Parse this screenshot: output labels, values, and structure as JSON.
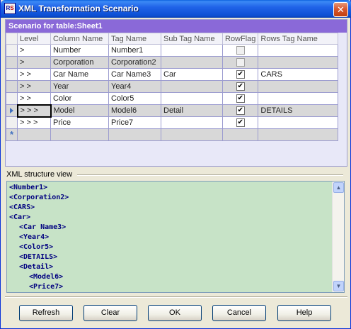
{
  "window": {
    "title": "XML Transformation Scenario",
    "icon_text_left": "R",
    "icon_text_right": "S",
    "close_glyph": "✕"
  },
  "scenario": {
    "header": "Scenario for table:Sheet1",
    "columns": [
      "Level",
      "Column Name",
      "Tag Name",
      "Sub Tag Name",
      "RowFlag",
      "Rows Tag Name"
    ],
    "rows": [
      {
        "level": ">",
        "column_name": "Number",
        "tag_name": "Number1",
        "sub_tag": "",
        "row_flag": false,
        "rows_tag": "",
        "shaded": false,
        "selected": false
      },
      {
        "level": ">",
        "column_name": "Corporation",
        "tag_name": "Corporation2",
        "sub_tag": "",
        "row_flag": false,
        "rows_tag": "",
        "shaded": true,
        "selected": false
      },
      {
        "level": "> >",
        "column_name": "Car Name",
        "tag_name": "Car Name3",
        "sub_tag": "Car",
        "row_flag": true,
        "rows_tag": "CARS",
        "shaded": false,
        "selected": false
      },
      {
        "level": "> >",
        "column_name": "Year",
        "tag_name": "Year4",
        "sub_tag": "",
        "row_flag": true,
        "rows_tag": "",
        "shaded": true,
        "selected": false
      },
      {
        "level": "> >",
        "column_name": "Color",
        "tag_name": "Color5",
        "sub_tag": "",
        "row_flag": true,
        "rows_tag": "",
        "shaded": false,
        "selected": false
      },
      {
        "level": "> > >",
        "column_name": "Model",
        "tag_name": "Model6",
        "sub_tag": "Detail",
        "row_flag": true,
        "rows_tag": "DETAILS",
        "shaded": true,
        "selected": true
      },
      {
        "level": "> > >",
        "column_name": "Price",
        "tag_name": "Price7",
        "sub_tag": "",
        "row_flag": true,
        "rows_tag": "",
        "shaded": false,
        "selected": false
      }
    ],
    "new_row_glyph": "*"
  },
  "xml_view": {
    "label": "XML structure view",
    "lines": [
      {
        "indent": 0,
        "text": "<Number1>"
      },
      {
        "indent": 0,
        "text": "<Corporation2>"
      },
      {
        "indent": 0,
        "text": "<CARS>"
      },
      {
        "indent": 0,
        "text": "<Car>"
      },
      {
        "indent": 1,
        "text": "<Car Name3>"
      },
      {
        "indent": 1,
        "text": "<Year4>"
      },
      {
        "indent": 1,
        "text": "<Color5>"
      },
      {
        "indent": 1,
        "text": "<DETAILS>"
      },
      {
        "indent": 1,
        "text": "<Detail>"
      },
      {
        "indent": 2,
        "text": "<Model6>"
      },
      {
        "indent": 2,
        "text": "<Price7>"
      }
    ]
  },
  "buttons": {
    "refresh": "Refresh",
    "clear": "Clear",
    "ok": "OK",
    "cancel": "Cancel",
    "help": "Help"
  }
}
